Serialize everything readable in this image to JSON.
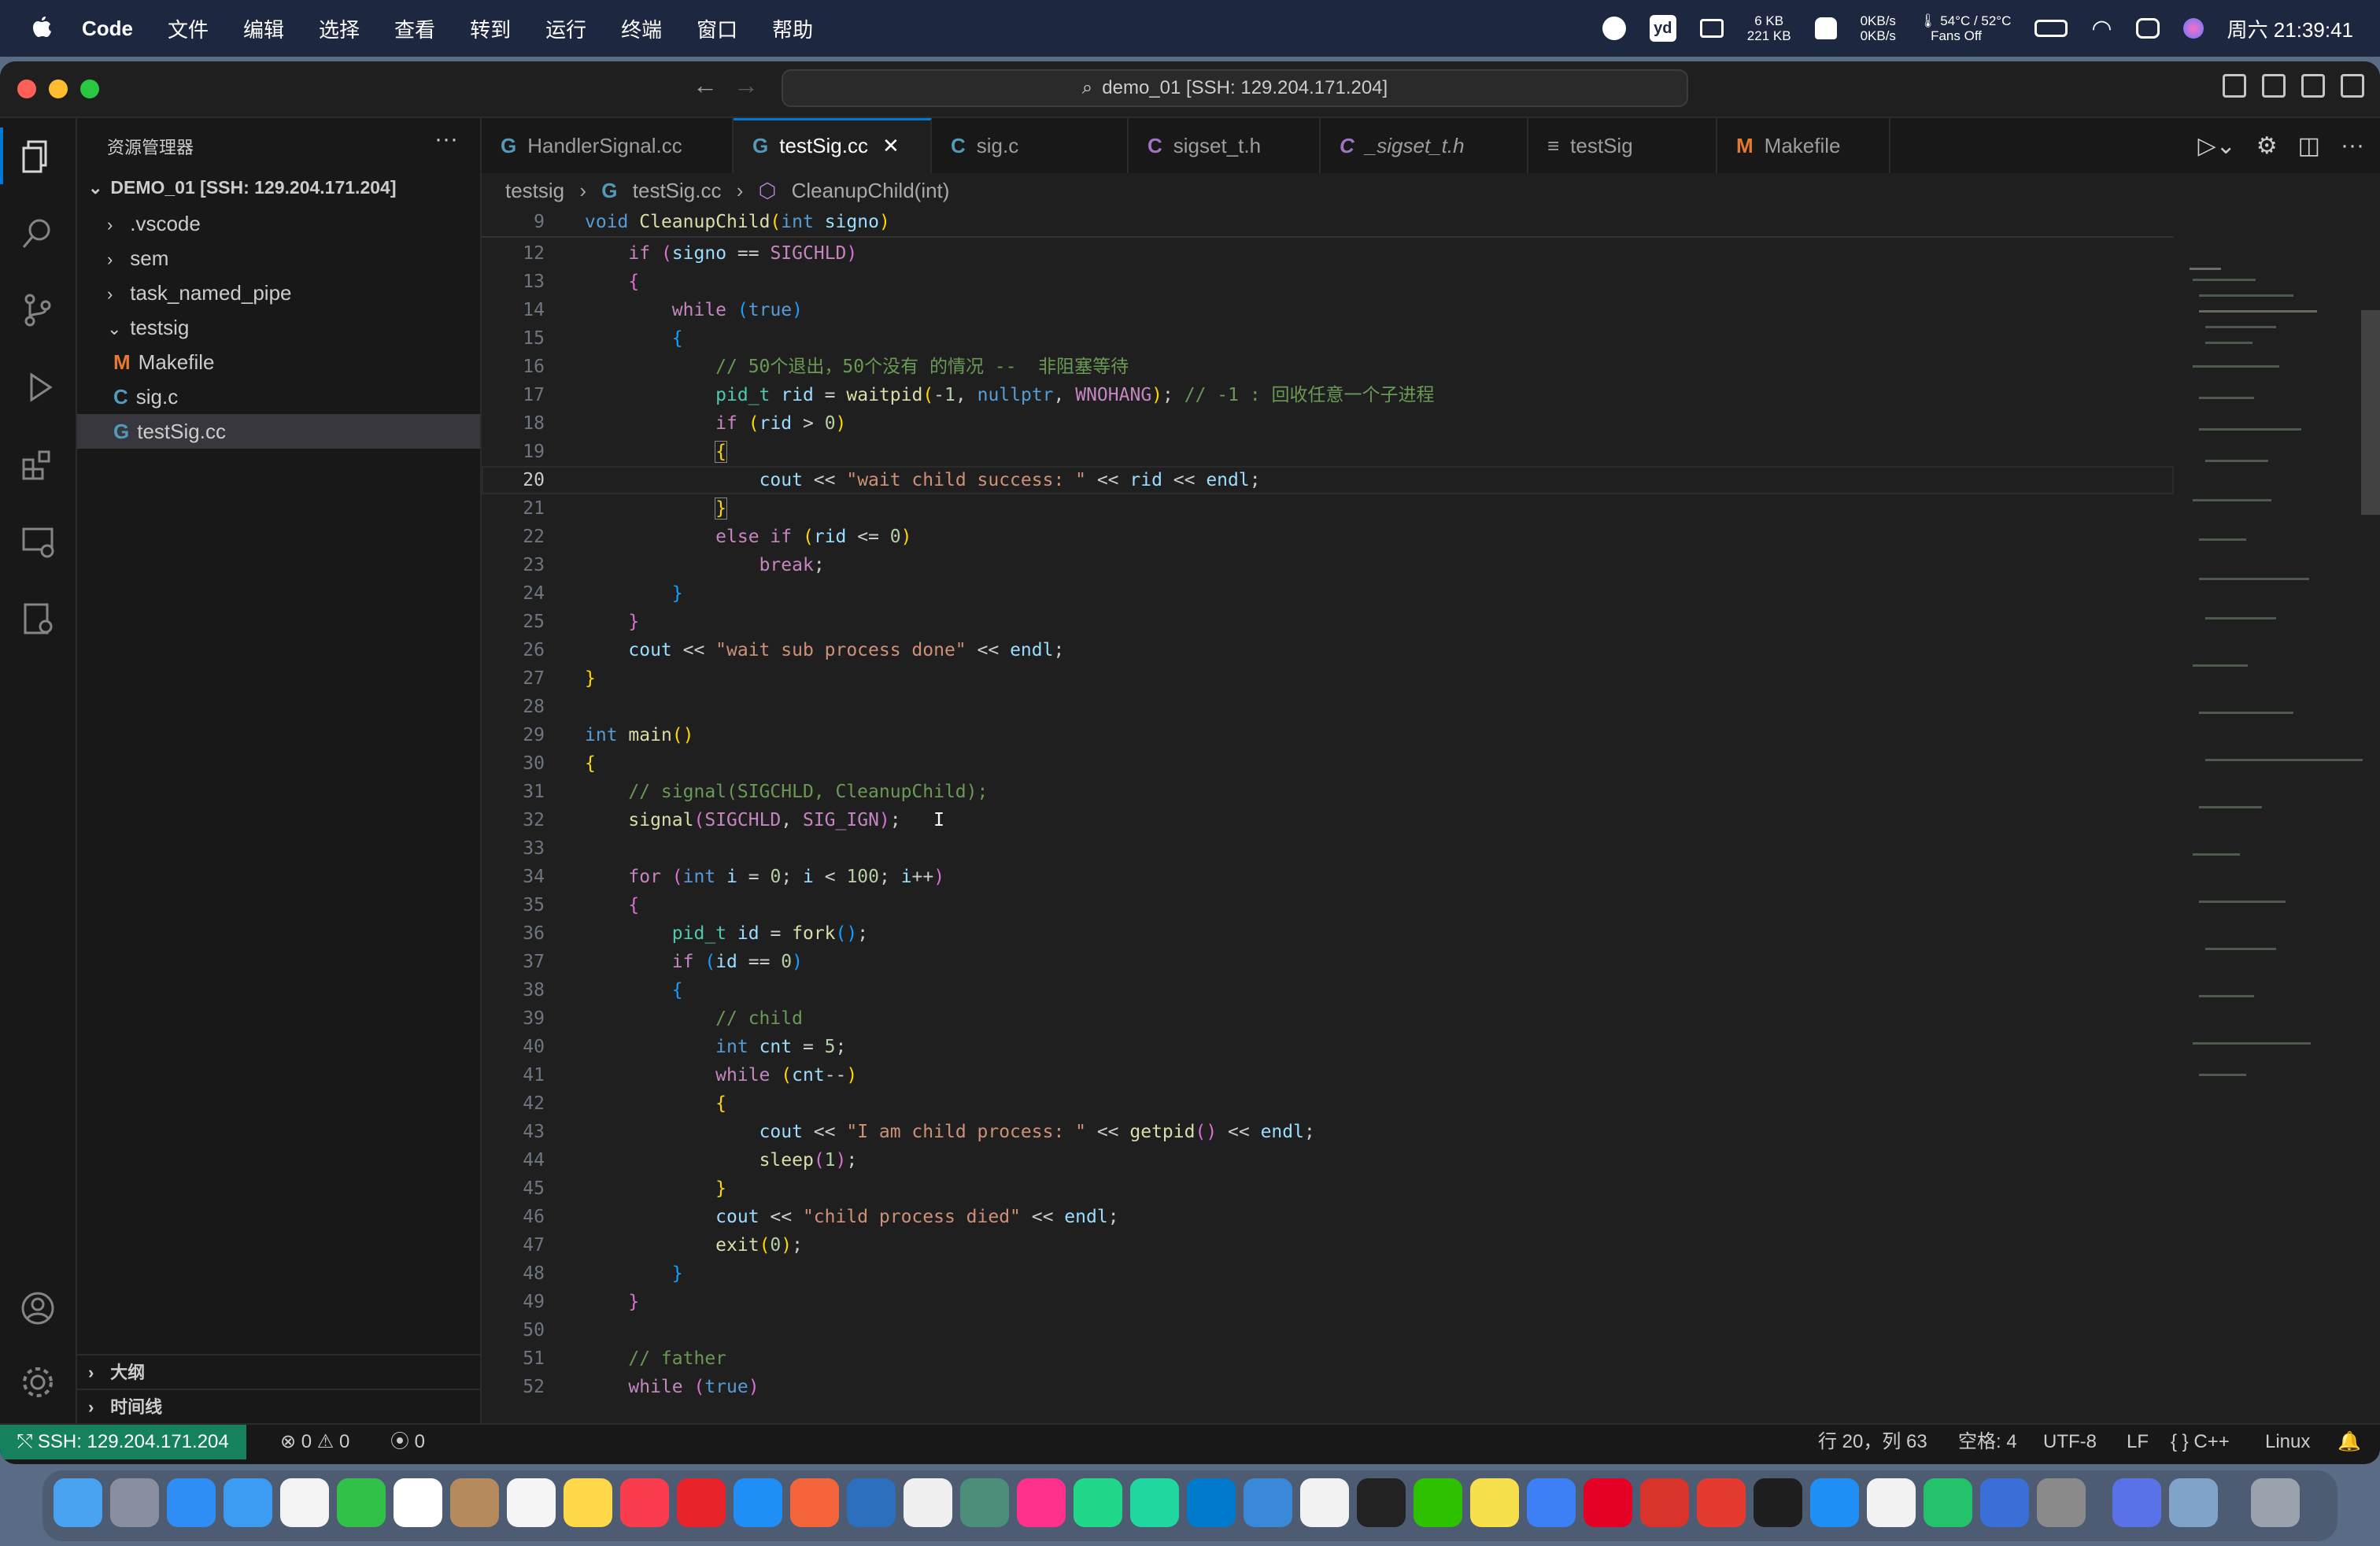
{
  "menubar": {
    "app": "Code",
    "items": [
      "文件",
      "编辑",
      "选择",
      "查看",
      "转到",
      "运行",
      "终端",
      "窗口",
      "帮助"
    ],
    "net_up": "6 KB",
    "net_down": "221 KB",
    "speed_up": "0KB/s",
    "speed_down": "0KB/s",
    "temp": "54°C / 52°C",
    "fans": "Fans Off",
    "clock": "周六 21:39:41",
    "yd": "yd"
  },
  "titlebar": {
    "search": "demo_01 [SSH: 129.204.171.204]"
  },
  "sidebar": {
    "title": "资源管理器",
    "more": "···",
    "root": "DEMO_01 [SSH: 129.204.171.204]",
    "items": [
      ".vscode",
      "sem",
      "task_named_pipe",
      "testsig"
    ],
    "children": [
      {
        "icon": "M",
        "name": "Makefile"
      },
      {
        "icon": "C",
        "name": "sig.c"
      },
      {
        "icon": "G",
        "name": "testSig.cc"
      }
    ],
    "outline": "大纲",
    "timeline": "时间线"
  },
  "tabs": [
    {
      "icon": "G",
      "label": "HandlerSignal.cc"
    },
    {
      "icon": "G",
      "label": "testSig.cc",
      "close": "✕"
    },
    {
      "icon": "C",
      "label": "sig.c"
    },
    {
      "icon": "C",
      "label": "sigset_t.h"
    },
    {
      "icon": "C",
      "label": "_sigset_t.h"
    },
    {
      "icon": "≡",
      "label": "testSig"
    },
    {
      "icon": "M",
      "label": "Makefile"
    }
  ],
  "breadcrumb": {
    "folder": "testsig",
    "file": "testSig.cc",
    "symbol": "CleanupChild(int)",
    "sep": "›",
    "file_icon": "G",
    "symbol_icon": "⬡"
  },
  "editor": {
    "sticky_line": "9"
  },
  "statusbar": {
    "remote": "SSH: 129.204.171.204",
    "errors": "⊗ 0 ⚠ 0",
    "ports": "0",
    "position": "行 20，列 63",
    "spaces": "空格: 4",
    "encoding": "UTF-8",
    "eol": "LF",
    "language": "{ } C++",
    "os": "Linux"
  },
  "colors": {
    "accent": "#0078d4",
    "remote": "#16825d",
    "editor_bg": "#1f1f1f",
    "sidebar_bg": "#181818"
  }
}
